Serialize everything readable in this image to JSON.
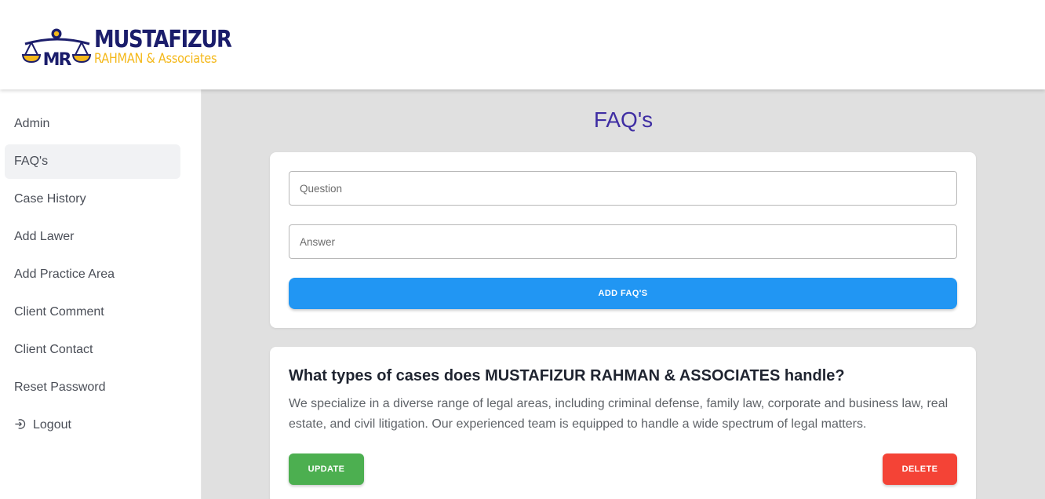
{
  "brand": {
    "title": "MUSTAFIZUR",
    "subtitle": "RAHMAN & Associates",
    "monogram": "MR",
    "colors": {
      "navy": "#1b1d6b",
      "gold": "#f4b81a"
    }
  },
  "sidebar": {
    "items": [
      {
        "label": "Admin",
        "active": false
      },
      {
        "label": "FAQ's",
        "active": true
      },
      {
        "label": "Case History",
        "active": false
      },
      {
        "label": "Add Lawer",
        "active": false
      },
      {
        "label": "Add Practice Area",
        "active": false
      },
      {
        "label": "Client Comment",
        "active": false
      },
      {
        "label": "Client Contact",
        "active": false
      },
      {
        "label": "Reset Password",
        "active": false
      }
    ],
    "logout": {
      "label": "Logout",
      "icon": "logout-icon"
    }
  },
  "main": {
    "title": "FAQ's",
    "form": {
      "question_placeholder": "Question",
      "question_value": "",
      "answer_placeholder": "Answer",
      "answer_value": "",
      "add_label": "ADD FAQ'S"
    },
    "faqs": [
      {
        "question": "What types of cases does MUSTAFIZUR RAHMAN & ASSOCIATES handle?",
        "answer": "We specialize in a diverse range of legal areas, including criminal defense, family law, corporate and business law, real estate, and civil litigation. Our experienced team is equipped to handle a wide spectrum of legal matters.",
        "update_label": "UPDATE",
        "delete_label": "DELETE"
      }
    ]
  },
  "colors": {
    "accent": "#2196f3",
    "title": "#3f2ea3",
    "update": "#4caf50",
    "delete": "#f44336",
    "content_bg": "#e0e0e0"
  }
}
